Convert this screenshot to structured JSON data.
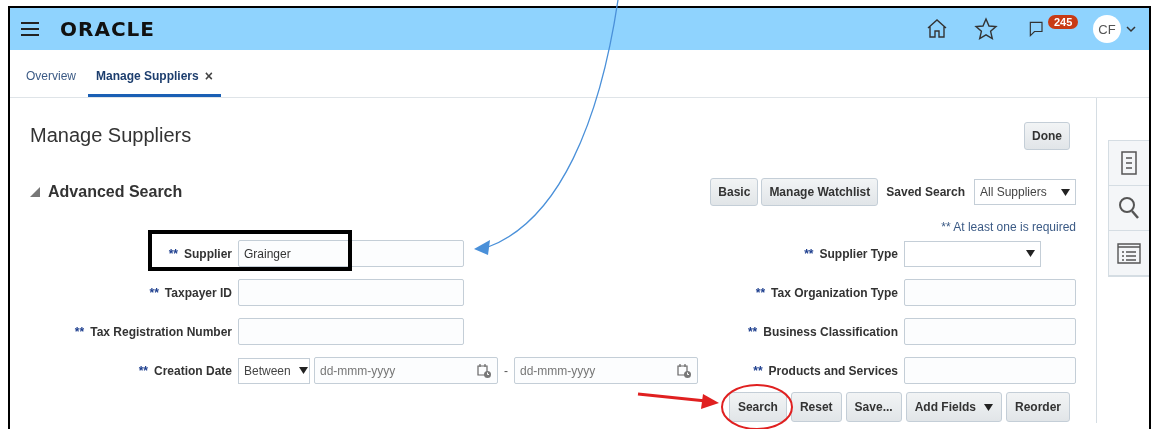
{
  "header": {
    "logo": "ORACLE",
    "notification_count": "245",
    "avatar_initials": "CF"
  },
  "tabs": [
    {
      "label": "Overview",
      "selected": false
    },
    {
      "label": "Manage Suppliers",
      "selected": true,
      "close": "×"
    }
  ],
  "page": {
    "title": "Manage Suppliers",
    "done_button": "Done"
  },
  "search": {
    "title": "Advanced Search",
    "expanded": true,
    "buttons": [
      "Basic",
      "Manage Watchlist"
    ],
    "saved_search": {
      "label": "Saved Search",
      "value": "All Suppliers"
    },
    "required_note": "** At least one is required",
    "left_fields": [
      {
        "marker": "**",
        "label": "Supplier",
        "kind": "text",
        "value": "Grainger"
      },
      {
        "marker": "**",
        "label": "Taxpayer ID",
        "kind": "text"
      },
      {
        "marker": "**",
        "label": "Tax Registration Number",
        "kind": "text"
      },
      {
        "marker": "**",
        "label": "Creation Date",
        "kind": "date_range",
        "operator": "Between",
        "from_placeholder": "dd-mmm-yyyy",
        "separator": "-",
        "to_placeholder": "dd-mmm-yyyy"
      }
    ],
    "right_fields": [
      {
        "marker": "**",
        "label": "Supplier Type",
        "kind": "select"
      },
      {
        "marker": "**",
        "label": "Tax Organization Type",
        "kind": "text"
      },
      {
        "marker": "**",
        "label": "Business Classification",
        "kind": "text"
      },
      {
        "marker": "**",
        "label": "Products and Services",
        "kind": "text"
      }
    ],
    "actions": [
      {
        "label": "Search",
        "kind": "button"
      },
      {
        "label": "Reset",
        "kind": "button"
      },
      {
        "label": "Save...",
        "kind": "button"
      },
      {
        "label": "Add Fields",
        "kind": "menu"
      },
      {
        "label": "Reorder",
        "kind": "button"
      }
    ]
  }
}
